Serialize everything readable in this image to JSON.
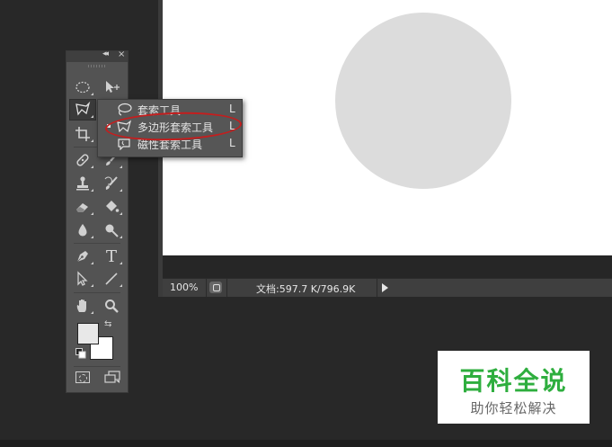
{
  "status_bar": {
    "zoom": "100%",
    "doc_info": "文档:597.7 K/796.9K"
  },
  "toolbox": {
    "collapse_glyph": "◂◂",
    "close_glyph": "×",
    "swap_glyph": "⇆",
    "tools": [
      {
        "name": "marquee-tool-icon"
      },
      {
        "name": "move-tool-icon"
      },
      {
        "name": "lasso-tool-icon",
        "active": true
      },
      {
        "name": "quick-selection-tool-icon"
      },
      {
        "name": "crop-tool-icon"
      },
      {
        "name": "eyedropper-tool-icon"
      },
      {
        "name": "healing-brush-tool-icon"
      },
      {
        "name": "brush-tool-icon"
      },
      {
        "name": "clone-stamp-tool-icon"
      },
      {
        "name": "history-brush-tool-icon"
      },
      {
        "name": "eraser-tool-icon"
      },
      {
        "name": "paint-bucket-tool-icon"
      },
      {
        "name": "blur-tool-icon"
      },
      {
        "name": "dodge-tool-icon"
      },
      {
        "name": "pen-tool-icon"
      },
      {
        "name": "type-tool-icon",
        "glyph": "T"
      },
      {
        "name": "path-selection-tool-icon"
      },
      {
        "name": "line-tool-icon"
      },
      {
        "name": "hand-tool-icon"
      },
      {
        "name": "zoom-tool-icon"
      }
    ],
    "foreground_color": "#e8e8e8",
    "background_color": "#ffffff"
  },
  "flyout": {
    "items": [
      {
        "label": "套索工具",
        "key": "L",
        "selected": false,
        "icon": "lasso-icon"
      },
      {
        "label": "多边形套索工具",
        "key": "L",
        "selected": true,
        "icon": "polygonal-lasso-icon"
      },
      {
        "label": "磁性套索工具",
        "key": "L",
        "selected": false,
        "icon": "magnetic-lasso-icon"
      }
    ],
    "highlight_color": "#c41e1e"
  },
  "watermark": {
    "title": "百科全说",
    "subtitle": "助你轻松解决",
    "title_color": "#2eae3e"
  }
}
